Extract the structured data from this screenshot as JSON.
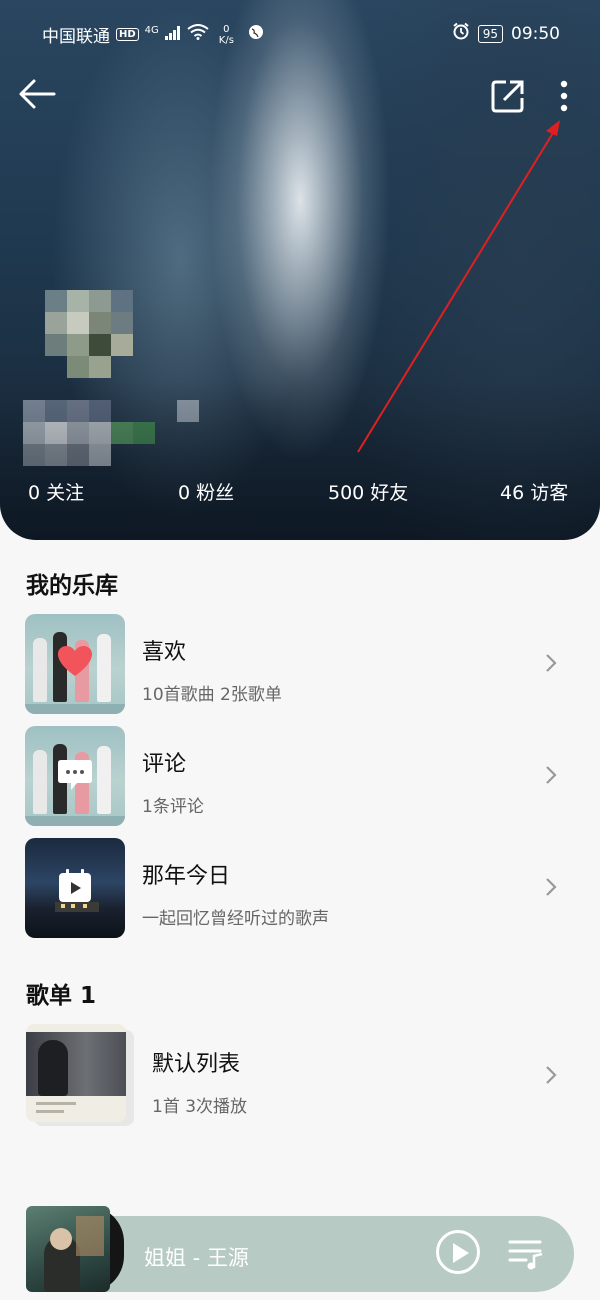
{
  "status_bar": {
    "carrier": "中国联通",
    "hd_badge": "HD",
    "network": "4G",
    "speed_value": "0",
    "speed_unit": "K/s",
    "battery": "95",
    "time": "09:50"
  },
  "profile": {
    "stats": [
      {
        "label": "0 关注"
      },
      {
        "label": "0 粉丝"
      },
      {
        "label": "500 好友"
      },
      {
        "label": "46 访客"
      }
    ]
  },
  "library": {
    "title": "我的乐库",
    "items": [
      {
        "title": "喜欢",
        "subtitle": "10首歌曲 2张歌单",
        "icon": "heart-icon"
      },
      {
        "title": "评论",
        "subtitle": "1条评论",
        "icon": "comment-icon"
      },
      {
        "title": "那年今日",
        "subtitle": "一起回忆曾经听过的歌声",
        "icon": "calendar-play-icon"
      }
    ]
  },
  "playlists": {
    "title": "歌单 1",
    "items": [
      {
        "title": "默认列表",
        "subtitle": "1首 3次播放"
      }
    ]
  },
  "player": {
    "now_playing": "姐姐 - 王源"
  },
  "colors": {
    "accent_annotation": "#e02020",
    "player_bar": "#b7cbc4",
    "background": "#f7f7f7"
  }
}
